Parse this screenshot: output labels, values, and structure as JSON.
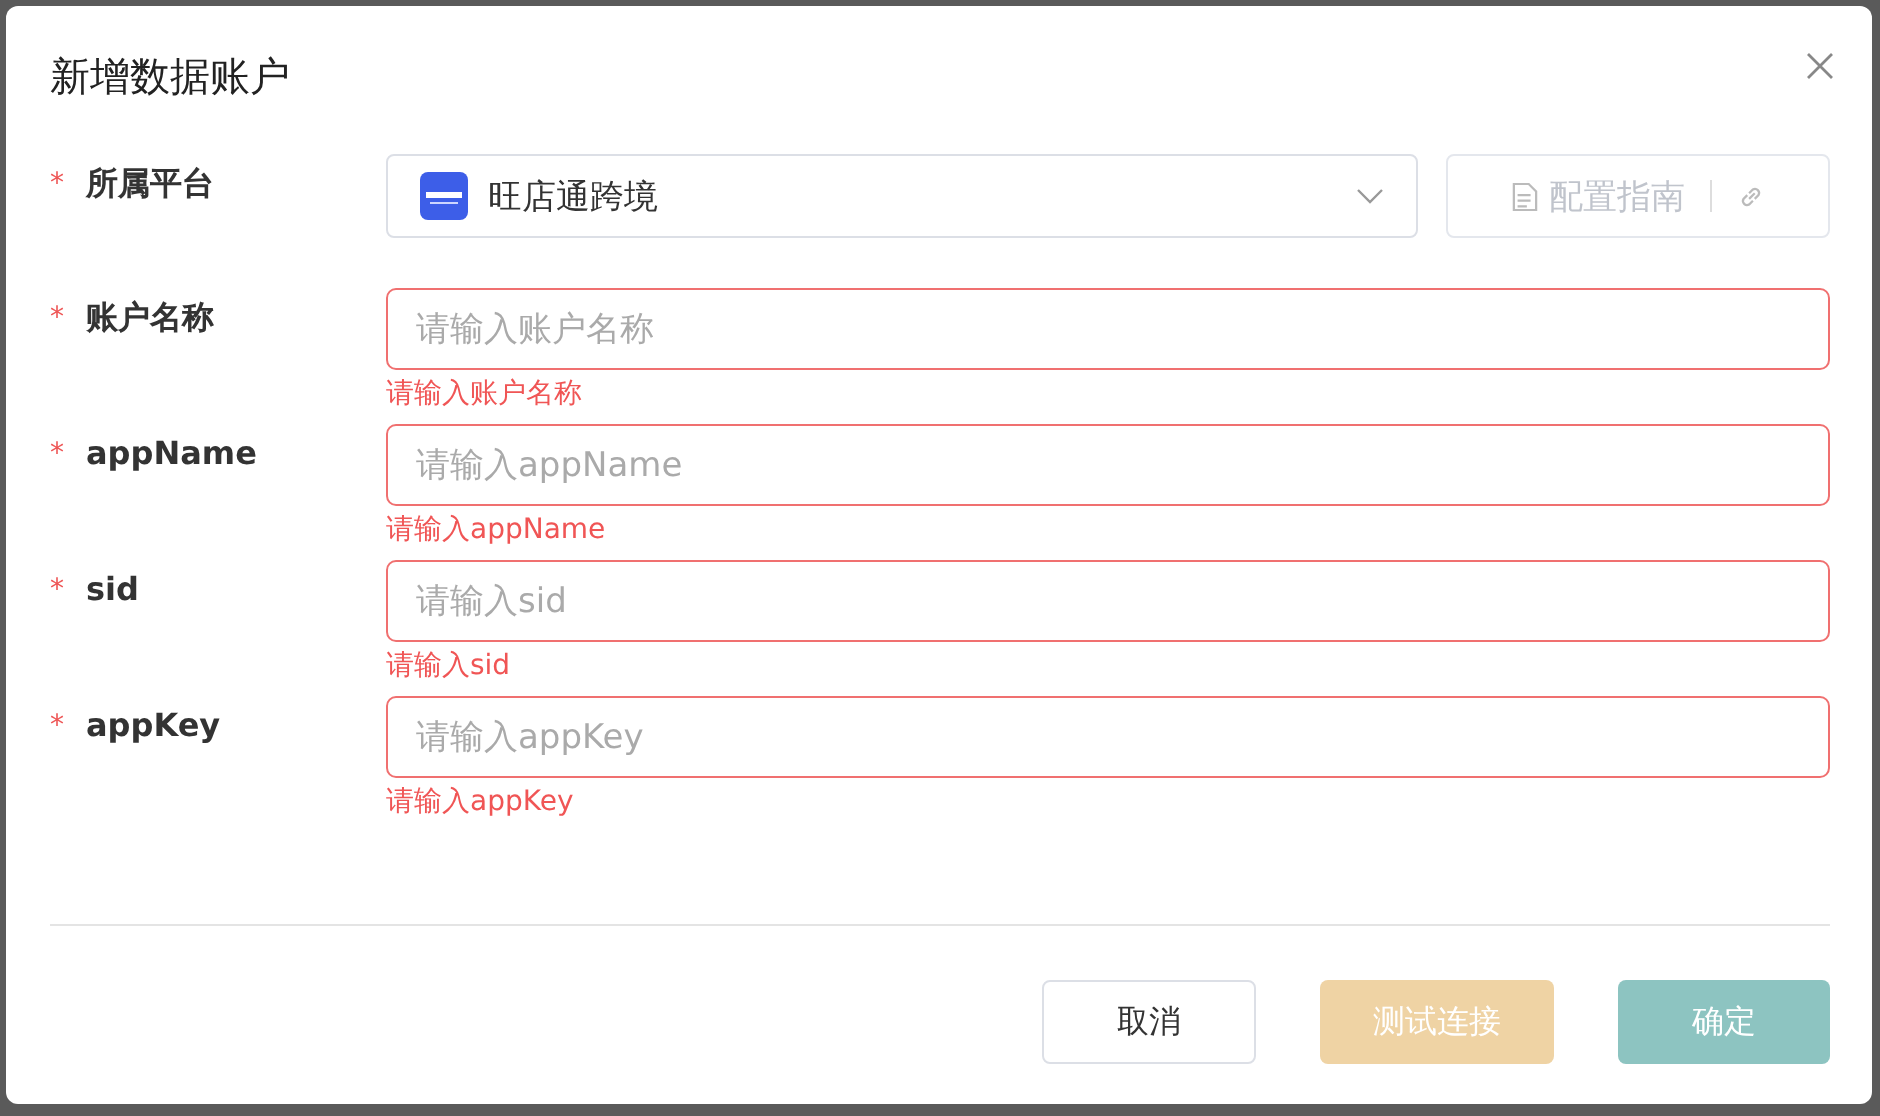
{
  "dialog": {
    "title": "新增数据账户"
  },
  "platform": {
    "label": "所属平台",
    "required_mark": "*",
    "value": "旺店通跨境",
    "guide_button": {
      "label": "配置指南",
      "disabled": true
    }
  },
  "fields": [
    {
      "label": "账户名称",
      "required_mark": "*",
      "placeholder": "请输入账户名称",
      "error": "请输入账户名称"
    },
    {
      "label": "appName",
      "required_mark": "*",
      "placeholder": "请输入appName",
      "error": "请输入appName"
    },
    {
      "label": "sid",
      "required_mark": "*",
      "placeholder": "请输入sid",
      "error": "请输入sid"
    },
    {
      "label": "appKey",
      "required_mark": "*",
      "placeholder": "请输入appKey",
      "error": "请输入appKey"
    }
  ],
  "buttons": [
    {
      "label": "取消",
      "kind": "default",
      "disabled": false
    },
    {
      "label": "测试连接",
      "kind": "warning",
      "disabled": true
    },
    {
      "label": "确定",
      "kind": "primary",
      "disabled": true
    }
  ]
}
